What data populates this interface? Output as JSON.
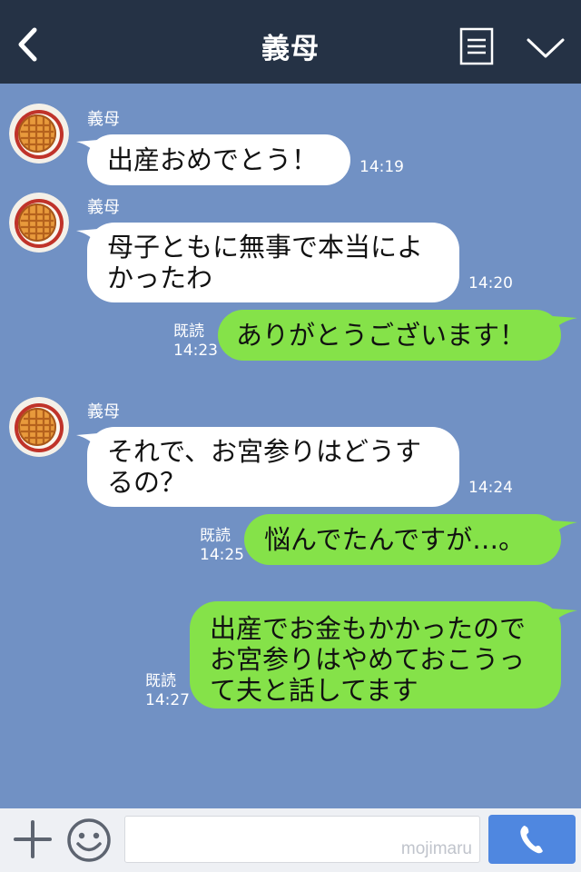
{
  "header": {
    "title": "義母",
    "icons": {
      "back": "chevron-left-icon",
      "menu": "menu-list-icon",
      "collapse": "chevron-down-icon"
    }
  },
  "messages": [
    {
      "sender": "義母",
      "direction": "incoming",
      "text": "出産おめでとう！",
      "time": "14:19"
    },
    {
      "sender": "義母",
      "direction": "incoming",
      "text": "母子ともに無事で本当によ\nかったわ",
      "time": "14:20"
    },
    {
      "direction": "outgoing",
      "text": "ありがとうございます！",
      "read": "既読",
      "time": "14:23"
    },
    {
      "sender": "義母",
      "direction": "incoming",
      "text": "それで、お宮参りはどうす\nるの？",
      "time": "14:24"
    },
    {
      "direction": "outgoing",
      "text": "悩んでたんですが…。",
      "read": "既読",
      "time": "14:25"
    },
    {
      "direction": "outgoing",
      "text": "出産でお金もかかったので\nお宮参りはやめておこうっ\nて夫と話してます",
      "read": "既読",
      "time": "14:27"
    }
  ],
  "footer": {
    "watermark": "mojimaru",
    "icons": {
      "add": "plus-icon",
      "sticker": "smiley-icon",
      "call": "phone-icon"
    }
  },
  "colors": {
    "header": "#253245",
    "background": "#7191c4",
    "outgoing_bubble": "#85e249",
    "incoming_bubble": "#ffffff",
    "call_button": "#4f87e0"
  }
}
